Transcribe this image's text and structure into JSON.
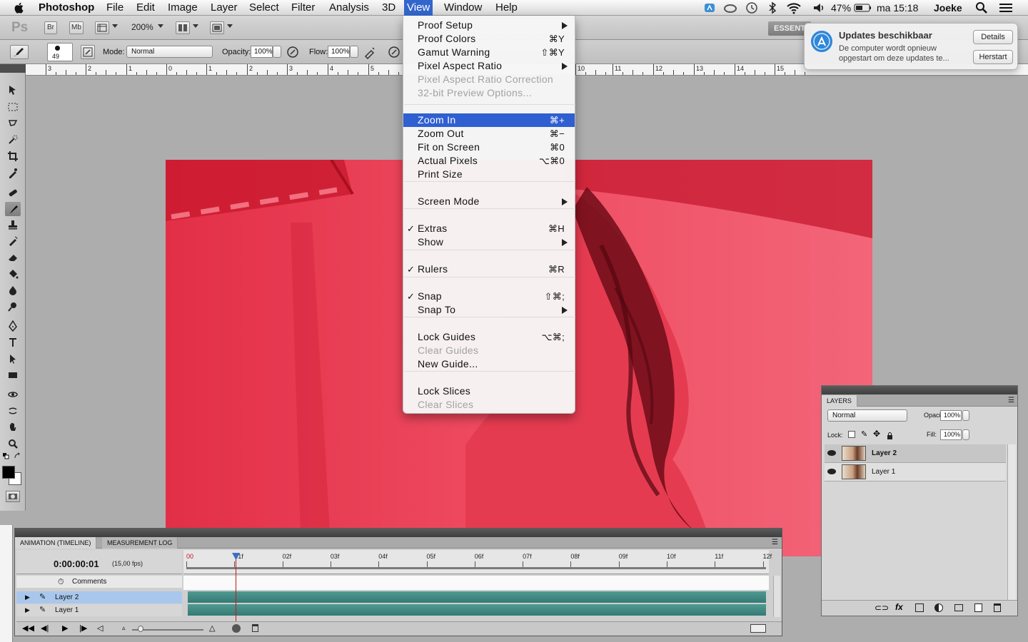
{
  "menubar": {
    "app_name": "Photoshop",
    "items": [
      "File",
      "Edit",
      "Image",
      "Layer",
      "Select",
      "Filter",
      "Analysis",
      "3D",
      "View",
      "Window",
      "Help"
    ],
    "active_item": "View",
    "status": {
      "battery": "47%",
      "clock": "ma 15:18",
      "user": "Joeke"
    }
  },
  "appbar": {
    "logo": "Ps",
    "bridge": "Br",
    "mini_bridge": "Mb",
    "zoom": "200%",
    "workspace": "ESSENT"
  },
  "options": {
    "brush_size": "49",
    "mode_label": "Mode:",
    "mode_value": "Normal",
    "opacity_label": "Opacity:",
    "opacity_value": "100%",
    "flow_label": "Flow:",
    "flow_value": "100%"
  },
  "ruler": {
    "labels": [
      "3",
      "2",
      "1",
      "0",
      "1",
      "2",
      "3",
      "4",
      "5",
      "10",
      "11",
      "12",
      "13",
      "14",
      "15"
    ]
  },
  "view_menu": {
    "items": [
      {
        "label": "Proof Setup",
        "shortcut": "",
        "submenu": true,
        "disabled": false,
        "checked": false
      },
      {
        "label": "Proof Colors",
        "shortcut": "⌘Y",
        "submenu": false,
        "disabled": false,
        "checked": false
      },
      {
        "label": "Gamut Warning",
        "shortcut": "⇧⌘Y",
        "submenu": false,
        "disabled": false,
        "checked": false
      },
      {
        "label": "Pixel Aspect Ratio",
        "shortcut": "",
        "submenu": true,
        "disabled": false,
        "checked": false
      },
      {
        "label": "Pixel Aspect Ratio Correction",
        "shortcut": "",
        "submenu": false,
        "disabled": true,
        "checked": false
      },
      {
        "label": "32-bit Preview Options...",
        "shortcut": "",
        "submenu": false,
        "disabled": true,
        "checked": false
      },
      {
        "label": "Zoom In",
        "shortcut": "⌘+",
        "submenu": false,
        "disabled": false,
        "checked": false,
        "highlighted": true
      },
      {
        "label": "Zoom Out",
        "shortcut": "⌘−",
        "submenu": false,
        "disabled": false,
        "checked": false
      },
      {
        "label": "Fit on Screen",
        "shortcut": "⌘0",
        "submenu": false,
        "disabled": false,
        "checked": false
      },
      {
        "label": "Actual Pixels",
        "shortcut": "⌥⌘0",
        "submenu": false,
        "disabled": false,
        "checked": false
      },
      {
        "label": "Print Size",
        "shortcut": "",
        "submenu": false,
        "disabled": false,
        "checked": false
      },
      {
        "label": "Screen Mode",
        "shortcut": "",
        "submenu": true,
        "disabled": false,
        "checked": false
      },
      {
        "label": "Extras",
        "shortcut": "⌘H",
        "submenu": false,
        "disabled": false,
        "checked": true
      },
      {
        "label": "Show",
        "shortcut": "",
        "submenu": true,
        "disabled": false,
        "checked": false
      },
      {
        "label": "Rulers",
        "shortcut": "⌘R",
        "submenu": false,
        "disabled": false,
        "checked": true
      },
      {
        "label": "Snap",
        "shortcut": "⇧⌘;",
        "submenu": false,
        "disabled": false,
        "checked": true
      },
      {
        "label": "Snap To",
        "shortcut": "",
        "submenu": true,
        "disabled": false,
        "checked": false
      },
      {
        "label": "Lock Guides",
        "shortcut": "⌥⌘;",
        "submenu": false,
        "disabled": false,
        "checked": false
      },
      {
        "label": "Clear Guides",
        "shortcut": "",
        "submenu": false,
        "disabled": true,
        "checked": false
      },
      {
        "label": "New Guide...",
        "shortcut": "",
        "submenu": false,
        "disabled": false,
        "checked": false
      },
      {
        "label": "Lock Slices",
        "shortcut": "",
        "submenu": false,
        "disabled": false,
        "checked": false
      },
      {
        "label": "Clear Slices",
        "shortcut": "",
        "submenu": false,
        "disabled": true,
        "checked": false
      }
    ]
  },
  "notification": {
    "title": "Updates beschikbaar",
    "body": "De computer wordt opnieuw opgestart om deze updates te...",
    "details_button": "Details",
    "restart_button": "Herstart"
  },
  "layers_panel": {
    "tab": "LAYERS",
    "blend_mode": "Normal",
    "opacity_label": "Opacity:",
    "opacity_value": "100%",
    "lock_label": "Lock:",
    "fill_label": "Fill:",
    "fill_value": "100%",
    "layers": [
      {
        "name": "Layer 2",
        "selected": true
      },
      {
        "name": "Layer 1",
        "selected": false
      }
    ]
  },
  "timeline_panel": {
    "tabs": [
      "ANIMATION (TIMELINE)",
      "MEASUREMENT LOG"
    ],
    "time": "0:00:00:01",
    "fps": "(15,00 fps)",
    "frame_labels": [
      "00",
      "01f",
      "02f",
      "03f",
      "04f",
      "05f",
      "06f",
      "07f",
      "08f",
      "09f",
      "10f",
      "11f",
      "12f"
    ],
    "comments_label": "Comments",
    "rows": [
      {
        "name": "Layer 2",
        "selected": true
      },
      {
        "name": "Layer 1",
        "selected": false
      }
    ]
  },
  "colors": {
    "canvas_red": "#f04a5f",
    "menu_highlight": "#2f5fd1",
    "track_teal": "#3f8a82"
  }
}
